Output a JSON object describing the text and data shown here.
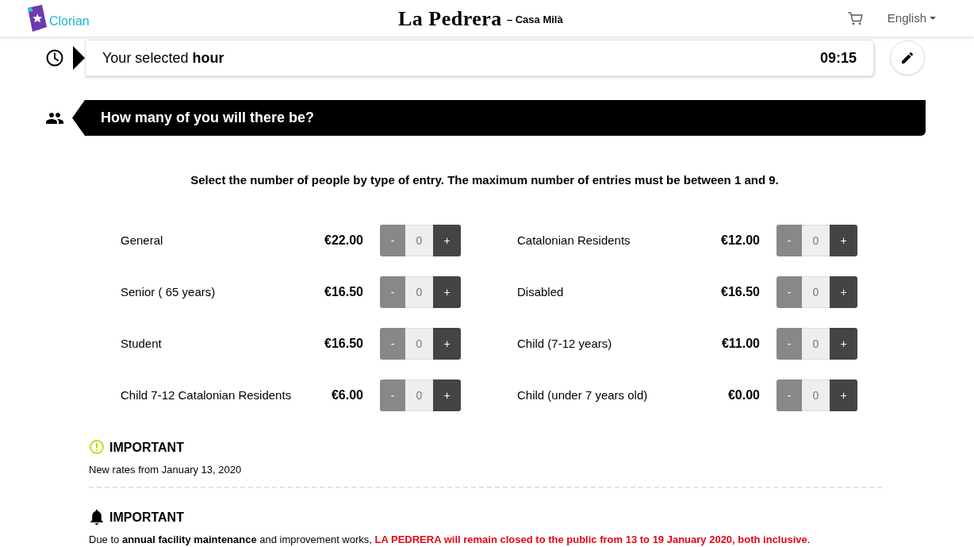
{
  "header": {
    "logo_text": "Clorian",
    "title": "La Pedrera",
    "subtitle": "– Casa Milà",
    "language": "English"
  },
  "hour": {
    "label": "Your selected **hour**",
    "value": "09:15"
  },
  "section": {
    "title": "How many of you will there be?"
  },
  "instructions": "Select the number of people by type of entry. The maximum number of entries must be between 1 and 9.",
  "tickets": [
    {
      "name": "General",
      "price": "€22.00",
      "decrement": "-",
      "count": "0",
      "increment": "+"
    },
    {
      "name": "Catalonian Residents",
      "price": "€12.00",
      "decrement": "-",
      "count": "0",
      "increment": "+"
    },
    {
      "name": "Senior ( 65 years)",
      "price": "€16.50",
      "decrement": "-",
      "count": "0",
      "increment": "+"
    },
    {
      "name": "Disabled",
      "price": "€16.50",
      "decrement": "-",
      "count": "0",
      "increment": "+"
    },
    {
      "name": "Student",
      "price": "€16.50",
      "decrement": "-",
      "count": "0",
      "increment": "+"
    },
    {
      "name": "Child (7-12 years)",
      "price": "€11.00",
      "decrement": "-",
      "count": "0",
      "increment": "+"
    },
    {
      "name": "Child 7-12 Catalonian Residents",
      "price": "€6.00",
      "decrement": "-",
      "count": "0",
      "increment": "+"
    },
    {
      "name": "Child (under 7 years old)",
      "price": "€0.00",
      "decrement": "-",
      "count": "0",
      "increment": "+"
    }
  ],
  "notices": [
    {
      "kind": "info",
      "title": "IMPORTANT",
      "text": [
        {
          "kind": "plain",
          "text": "New rates from January 13, 2020"
        }
      ]
    },
    {
      "kind": "alert",
      "title": "IMPORTANT",
      "text": [
        {
          "kind": "plain",
          "text": "Due to "
        },
        {
          "kind": "bold",
          "text": "annual facility maintenance"
        },
        {
          "kind": "plain",
          "text": " and improvement works, "
        },
        {
          "kind": "warning",
          "text": "LA PEDRERA will remain closed to the public from 13 to 19 January 2020, both inclusive"
        },
        {
          "kind": "plain",
          "text": "."
        }
      ]
    }
  ]
}
